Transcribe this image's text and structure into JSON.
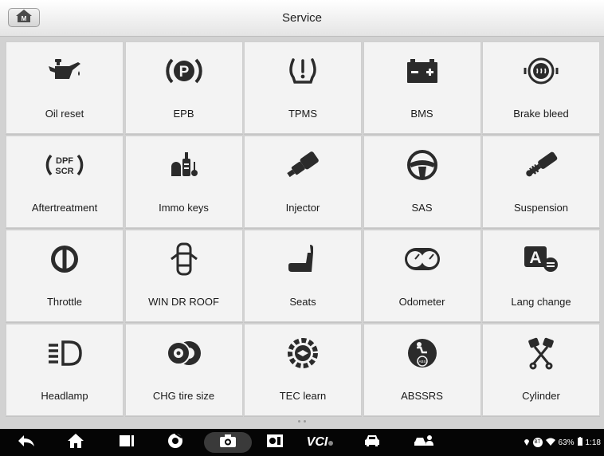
{
  "header": {
    "title": "Service",
    "home_badge": "M"
  },
  "tiles": [
    {
      "label": "Oil reset",
      "icon": "oil-can-icon"
    },
    {
      "label": "EPB",
      "icon": "parking-brake-icon"
    },
    {
      "label": "TPMS",
      "icon": "tire-pressure-icon"
    },
    {
      "label": "BMS",
      "icon": "battery-icon"
    },
    {
      "label": "Brake bleed",
      "icon": "brake-bleed-icon"
    },
    {
      "label": "Aftertreatment",
      "icon": "dpf-scr-icon",
      "icon_text_top": "DPF",
      "icon_text_bottom": "SCR"
    },
    {
      "label": "Immo keys",
      "icon": "immo-key-icon"
    },
    {
      "label": "Injector",
      "icon": "injector-icon"
    },
    {
      "label": "SAS",
      "icon": "steering-wheel-icon"
    },
    {
      "label": "Suspension",
      "icon": "suspension-icon"
    },
    {
      "label": "Throttle",
      "icon": "throttle-icon"
    },
    {
      "label": "WIN DR ROOF",
      "icon": "car-top-view-icon"
    },
    {
      "label": "Seats",
      "icon": "seat-icon"
    },
    {
      "label": "Odometer",
      "icon": "odometer-icon"
    },
    {
      "label": "Lang change",
      "icon": "language-icon",
      "icon_text": "A"
    },
    {
      "label": "Headlamp",
      "icon": "headlamp-icon"
    },
    {
      "label": "CHG tire size",
      "icon": "tire-size-icon"
    },
    {
      "label": "TEC learn",
      "icon": "tec-learn-icon"
    },
    {
      "label": "ABSSRS",
      "icon": "abs-srs-icon",
      "icon_text": "ABS"
    },
    {
      "label": "Cylinder",
      "icon": "cylinder-icon"
    }
  ],
  "sysbar": {
    "vci_label": "VCI",
    "battery": "63%",
    "time": "1:18",
    "bt_badge": "BT"
  },
  "colors": {
    "tile_bg": "#f3f3f3",
    "icon": "#2b2b2b",
    "bar": "#050505"
  }
}
